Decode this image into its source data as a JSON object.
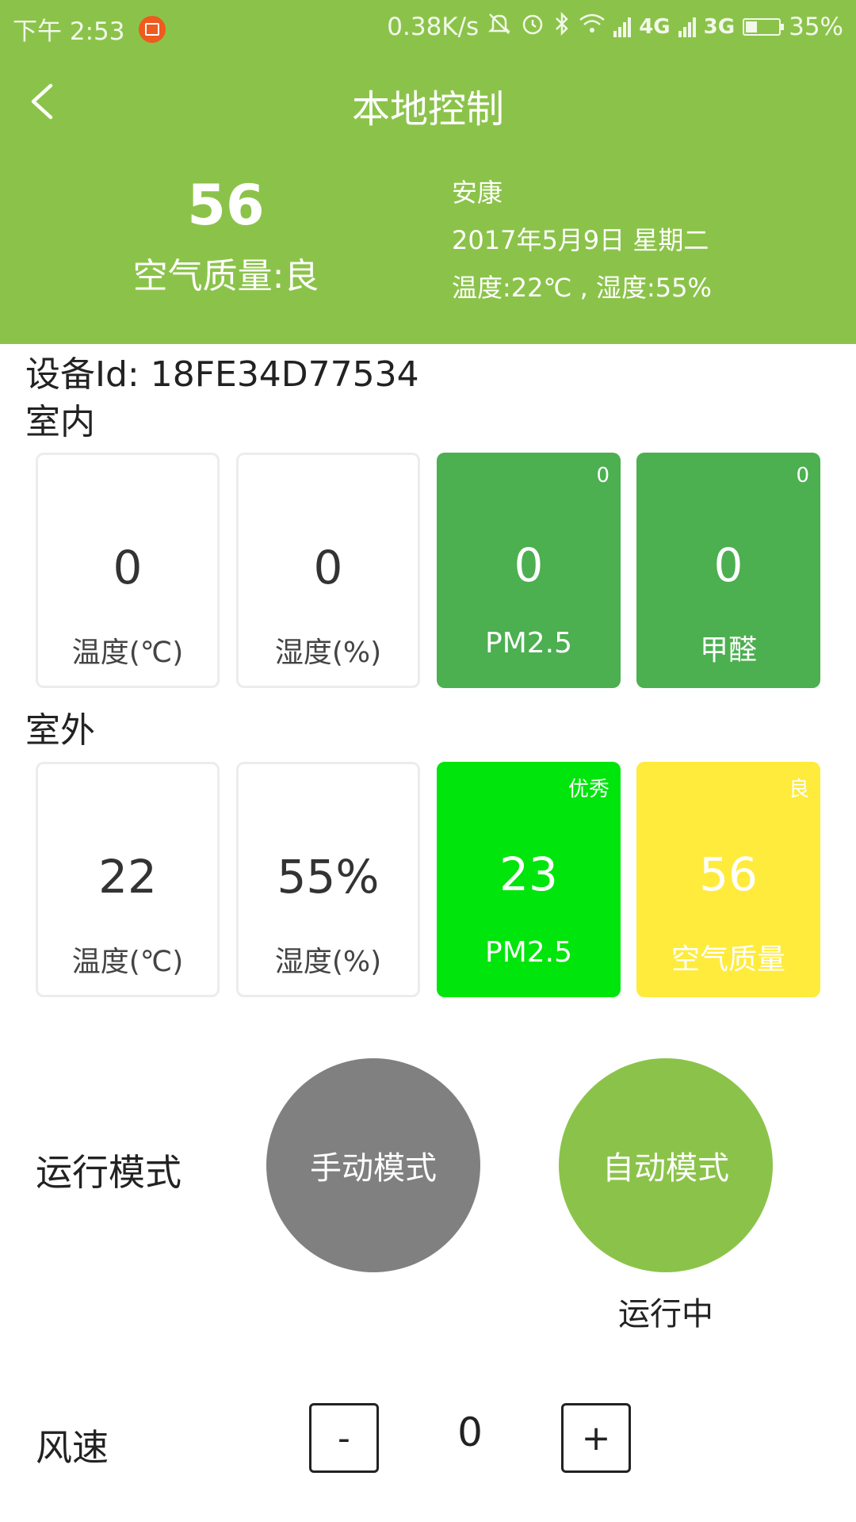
{
  "status_bar": {
    "time": "下午 2:53",
    "speed": "0.38K/s",
    "net1": "4G",
    "net2": "3G",
    "battery_percent": "35%",
    "battery_level": 0.35,
    "icons": [
      "notification-icon",
      "mute-icon",
      "alarm-icon",
      "bluetooth-icon",
      "wifi-icon",
      "signal-icon",
      "battery-icon"
    ]
  },
  "header": {
    "title": "本地控制",
    "aqi_value": "56",
    "aqi_label": "空气质量:良",
    "city": "安康",
    "date": "2017年5月9日 星期二",
    "weather": "温度:22℃ , 湿度:55%"
  },
  "device": {
    "id_text": "设备Id: 18FE34D77534"
  },
  "indoor": {
    "title": "室内",
    "cards": [
      {
        "value": "0",
        "label": "温度(℃)",
        "badge": ""
      },
      {
        "value": "0",
        "label": "湿度(%)",
        "badge": ""
      },
      {
        "value": "0",
        "label": "PM2.5",
        "badge": "0"
      },
      {
        "value": "0",
        "label": "甲醛",
        "badge": "0"
      }
    ]
  },
  "outdoor": {
    "title": "室外",
    "cards": [
      {
        "value": "22",
        "label": "温度(℃)",
        "badge": ""
      },
      {
        "value": "55%",
        "label": "湿度(%)",
        "badge": ""
      },
      {
        "value": "23",
        "label": "PM2.5",
        "badge": "优秀"
      },
      {
        "value": "56",
        "label": "空气质量",
        "badge": "良"
      }
    ]
  },
  "run_mode": {
    "label": "运行模式",
    "manual": "手动模式",
    "auto": "自动模式",
    "status": "运行中"
  },
  "wind": {
    "label": "风速",
    "minus": "-",
    "value": "0",
    "plus": "+"
  },
  "colors": {
    "header": "#8bc34a",
    "indoor_green": "#4caf50",
    "excellent_green": "#00e50b",
    "good_yellow": "#ffeb3b",
    "manual_gray": "#808080",
    "auto_green": "#8bc34a"
  }
}
